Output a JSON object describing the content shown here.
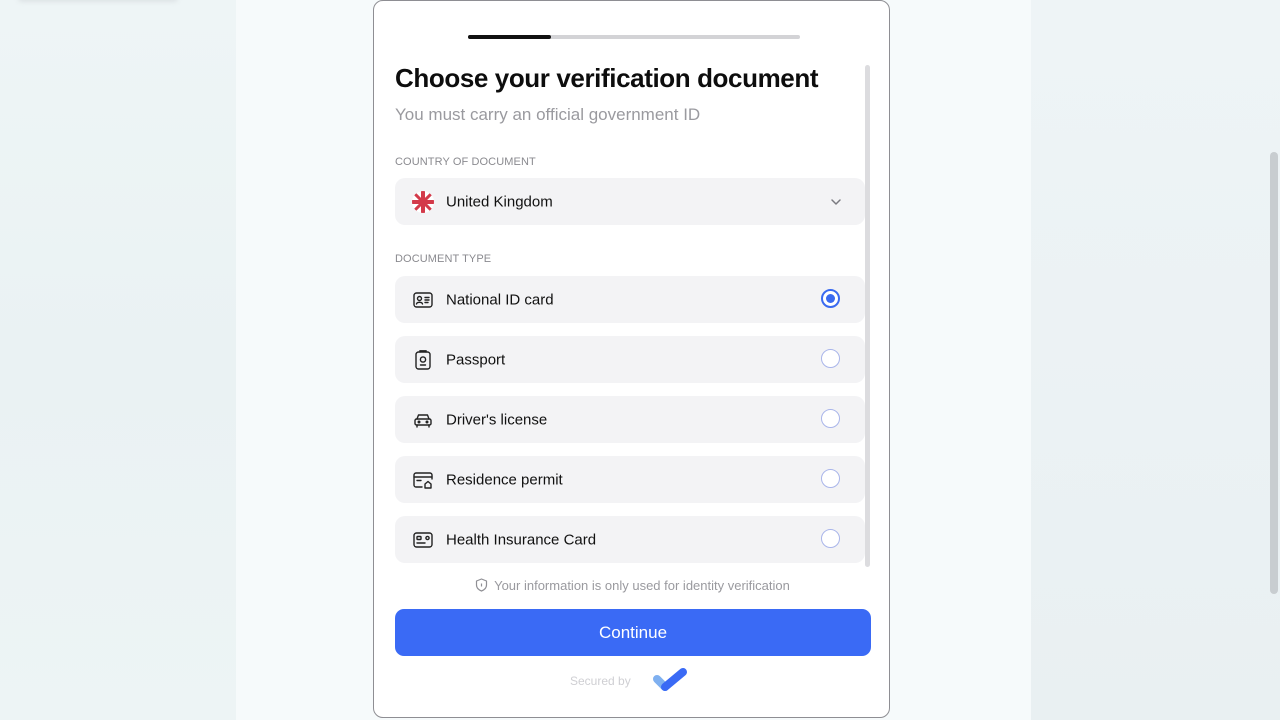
{
  "onboarding": {
    "progress_fraction": 0.25,
    "title": "Choose your verification document",
    "subtitle": "You must carry an official government ID",
    "country_section_label": "COUNTRY OF DOCUMENT",
    "selected_country": "United Kingdom",
    "document_section_label": "DOCUMENT TYPE",
    "documents": [
      {
        "label": "National ID card",
        "icon": "id-card-icon",
        "selected": true
      },
      {
        "label": "Passport",
        "icon": "passport-icon",
        "selected": false
      },
      {
        "label": "Driver's license",
        "icon": "car-icon",
        "selected": false
      },
      {
        "label": "Residence permit",
        "icon": "residence-permit-icon",
        "selected": false
      },
      {
        "label": "Health Insurance Card",
        "icon": "health-card-icon",
        "selected": false
      }
    ],
    "privacy_note": "Your information is only used for identity verification",
    "continue_label": "Continue",
    "secured_by": "Secured by"
  },
  "colors": {
    "accent": "#3a6af5",
    "row_background": "#f3f3f5",
    "progress": "#111111"
  }
}
